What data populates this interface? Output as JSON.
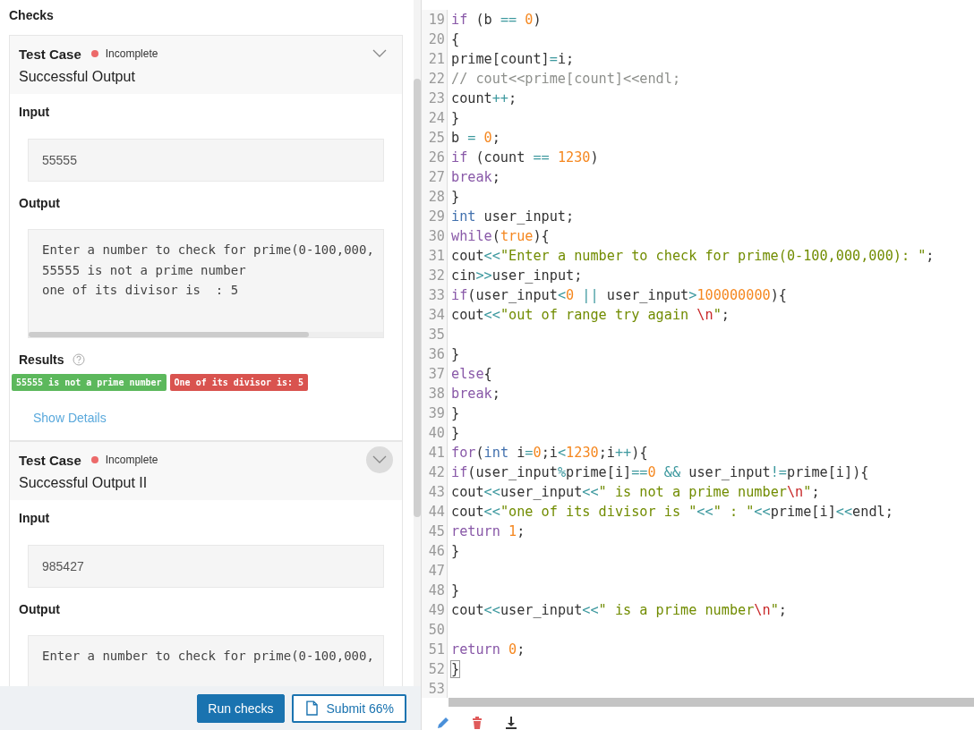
{
  "checks_panel": {
    "title": "Checks",
    "test_cases": [
      {
        "label": "Test Case",
        "status": "Incomplete",
        "color": "#ec6a6a",
        "title": "Successful Output",
        "toggle_hovered": false,
        "input_label": "Input",
        "input": "55555",
        "output_label": "Output",
        "output_lines": [
          "Enter a number to check for prime(0-100,000,",
          "55555 is not a prime number",
          "one of its divisor is  : 5"
        ],
        "results_label": "Results",
        "results": [
          {
            "text": "55555 is not a prime number",
            "kind": "pass"
          },
          {
            "text": "One of its divisor is: 5",
            "kind": "fail"
          }
        ],
        "details_link": "Show Details"
      },
      {
        "label": "Test Case",
        "status": "Incomplete",
        "color": "#ec6a6a",
        "title": "Successful Output II",
        "toggle_hovered": true,
        "input_label": "Input",
        "input": "985427",
        "output_label": "Output",
        "output_lines": [
          "Enter a number to check for prime(0-100,000,"
        ]
      }
    ],
    "buttons": [
      {
        "label": "Run checks",
        "kind": "primary"
      },
      {
        "label": "Submit 66%",
        "kind": "submit"
      }
    ]
  },
  "editor": {
    "lines": [
      {
        "number": "19",
        "tokens": [
          {
            "kind": "keyword",
            "text": "if"
          },
          {
            "kind": "plain",
            "text": " (b "
          },
          {
            "kind": "operator",
            "text": "=="
          },
          {
            "kind": "number",
            "text": " 0"
          },
          {
            "kind": "plain",
            "text": ")"
          }
        ]
      },
      {
        "number": "20",
        "tokens": [
          {
            "kind": "plain",
            "text": "{"
          }
        ]
      },
      {
        "number": "21",
        "tokens": [
          {
            "kind": "plain",
            "text": "prime[count]"
          },
          {
            "kind": "operator",
            "text": "="
          },
          {
            "kind": "plain",
            "text": "i;"
          }
        ]
      },
      {
        "number": "22",
        "tokens": [
          {
            "kind": "comment",
            "text": "// cout<<prime[count]<<endl;"
          }
        ]
      },
      {
        "number": "23",
        "tokens": [
          {
            "kind": "plain",
            "text": "count"
          },
          {
            "kind": "operator",
            "text": "++"
          },
          {
            "kind": "plain",
            "text": ";"
          }
        ]
      },
      {
        "number": "24",
        "tokens": [
          {
            "kind": "plain",
            "text": "}"
          }
        ]
      },
      {
        "number": "25",
        "tokens": [
          {
            "kind": "plain",
            "text": "b "
          },
          {
            "kind": "operator",
            "text": "="
          },
          {
            "kind": "number",
            "text": " 0"
          },
          {
            "kind": "plain",
            "text": ";"
          }
        ]
      },
      {
        "number": "26",
        "tokens": [
          {
            "kind": "keyword",
            "text": "if"
          },
          {
            "kind": "plain",
            "text": " (count "
          },
          {
            "kind": "operator",
            "text": "=="
          },
          {
            "kind": "number",
            "text": " 1230"
          },
          {
            "kind": "plain",
            "text": ")"
          }
        ]
      },
      {
        "number": "27",
        "tokens": [
          {
            "kind": "keyword",
            "text": "break"
          },
          {
            "kind": "plain",
            "text": ";"
          }
        ]
      },
      {
        "number": "28",
        "tokens": [
          {
            "kind": "plain",
            "text": "}"
          }
        ]
      },
      {
        "number": "29",
        "tokens": [
          {
            "kind": "type",
            "text": "int"
          },
          {
            "kind": "plain",
            "text": " user_input;"
          }
        ]
      },
      {
        "number": "30",
        "tokens": [
          {
            "kind": "keyword",
            "text": "while"
          },
          {
            "kind": "plain",
            "text": "("
          },
          {
            "kind": "number",
            "text": "true"
          },
          {
            "kind": "plain",
            "text": "){"
          }
        ]
      },
      {
        "number": "31",
        "tokens": [
          {
            "kind": "plain",
            "text": "cout"
          },
          {
            "kind": "operator",
            "text": "<<"
          },
          {
            "kind": "string",
            "text": "\"Enter a number to check for prime(0-100,000,000): \""
          },
          {
            "kind": "plain",
            "text": ";"
          }
        ]
      },
      {
        "number": "32",
        "tokens": [
          {
            "kind": "plain",
            "text": "cin"
          },
          {
            "kind": "operator",
            "text": ">>"
          },
          {
            "kind": "plain",
            "text": "user_input;"
          }
        ]
      },
      {
        "number": "33",
        "tokens": [
          {
            "kind": "keyword",
            "text": "if"
          },
          {
            "kind": "plain",
            "text": "(user_input"
          },
          {
            "kind": "operator",
            "text": "<"
          },
          {
            "kind": "number",
            "text": "0"
          },
          {
            "kind": "operator",
            "text": " ||"
          },
          {
            "kind": "plain",
            "text": " user_input"
          },
          {
            "kind": "operator",
            "text": ">"
          },
          {
            "kind": "number",
            "text": "100000000"
          },
          {
            "kind": "plain",
            "text": "){"
          }
        ]
      },
      {
        "number": "34",
        "tokens": [
          {
            "kind": "plain",
            "text": "cout"
          },
          {
            "kind": "operator",
            "text": "<<"
          },
          {
            "kind": "string",
            "text": "\"out of range try again "
          },
          {
            "kind": "escape",
            "text": "\\n"
          },
          {
            "kind": "string",
            "text": "\""
          },
          {
            "kind": "plain",
            "text": ";"
          }
        ]
      },
      {
        "number": "35"
      },
      {
        "number": "36",
        "tokens": [
          {
            "kind": "plain",
            "text": "}"
          }
        ]
      },
      {
        "number": "37",
        "tokens": [
          {
            "kind": "keyword",
            "text": "else"
          },
          {
            "kind": "plain",
            "text": "{"
          }
        ]
      },
      {
        "number": "38",
        "tokens": [
          {
            "kind": "keyword",
            "text": "break"
          },
          {
            "kind": "plain",
            "text": ";"
          }
        ]
      },
      {
        "number": "39",
        "tokens": [
          {
            "kind": "plain",
            "text": "}"
          }
        ]
      },
      {
        "number": "40",
        "tokens": [
          {
            "kind": "plain",
            "text": "}"
          }
        ]
      },
      {
        "number": "41",
        "tokens": [
          {
            "kind": "keyword",
            "text": "for"
          },
          {
            "kind": "plain",
            "text": "("
          },
          {
            "kind": "type",
            "text": "int"
          },
          {
            "kind": "plain",
            "text": " i"
          },
          {
            "kind": "operator",
            "text": "="
          },
          {
            "kind": "number",
            "text": "0"
          },
          {
            "kind": "plain",
            "text": ";i"
          },
          {
            "kind": "operator",
            "text": "<"
          },
          {
            "kind": "number",
            "text": "1230"
          },
          {
            "kind": "plain",
            "text": ";i"
          },
          {
            "kind": "operator",
            "text": "++"
          },
          {
            "kind": "plain",
            "text": "){"
          }
        ]
      },
      {
        "number": "42",
        "tokens": [
          {
            "kind": "keyword",
            "text": "if"
          },
          {
            "kind": "plain",
            "text": "(user_input"
          },
          {
            "kind": "operator",
            "text": "%"
          },
          {
            "kind": "plain",
            "text": "prime[i]"
          },
          {
            "kind": "operator",
            "text": "=="
          },
          {
            "kind": "number",
            "text": "0"
          },
          {
            "kind": "operator",
            "text": " &&"
          },
          {
            "kind": "plain",
            "text": " user_input"
          },
          {
            "kind": "operator",
            "text": "!="
          },
          {
            "kind": "plain",
            "text": "prime[i]){"
          }
        ]
      },
      {
        "number": "43",
        "tokens": [
          {
            "kind": "plain",
            "text": "cout"
          },
          {
            "kind": "operator",
            "text": "<<"
          },
          {
            "kind": "plain",
            "text": "user_input"
          },
          {
            "kind": "operator",
            "text": "<<"
          },
          {
            "kind": "string",
            "text": "\" is not a prime number"
          },
          {
            "kind": "escape",
            "text": "\\n"
          },
          {
            "kind": "string",
            "text": "\""
          },
          {
            "kind": "plain",
            "text": ";"
          }
        ]
      },
      {
        "number": "44",
        "tokens": [
          {
            "kind": "plain",
            "text": "cout"
          },
          {
            "kind": "operator",
            "text": "<<"
          },
          {
            "kind": "string",
            "text": "\"one of its divisor is \""
          },
          {
            "kind": "operator",
            "text": "<<"
          },
          {
            "kind": "string",
            "text": "\" : \""
          },
          {
            "kind": "operator",
            "text": "<<"
          },
          {
            "kind": "plain",
            "text": "prime[i]"
          },
          {
            "kind": "operator",
            "text": "<<"
          },
          {
            "kind": "plain",
            "text": "endl;"
          }
        ]
      },
      {
        "number": "45",
        "tokens": [
          {
            "kind": "keyword",
            "text": "return"
          },
          {
            "kind": "number",
            "text": " 1"
          },
          {
            "kind": "plain",
            "text": ";"
          }
        ]
      },
      {
        "number": "46",
        "tokens": [
          {
            "kind": "plain",
            "text": "}"
          }
        ]
      },
      {
        "number": "47"
      },
      {
        "number": "48",
        "tokens": [
          {
            "kind": "plain",
            "text": "}"
          }
        ]
      },
      {
        "number": "49",
        "tokens": [
          {
            "kind": "plain",
            "text": "cout"
          },
          {
            "kind": "operator",
            "text": "<<"
          },
          {
            "kind": "plain",
            "text": "user_input"
          },
          {
            "kind": "operator",
            "text": "<<"
          },
          {
            "kind": "string",
            "text": "\" is a prime number"
          },
          {
            "kind": "escape",
            "text": "\\n"
          },
          {
            "kind": "string",
            "text": "\""
          },
          {
            "kind": "plain",
            "text": ";"
          }
        ]
      },
      {
        "number": "50"
      },
      {
        "number": "51",
        "tokens": [
          {
            "kind": "keyword",
            "text": "return"
          },
          {
            "kind": "number",
            "text": " 0"
          },
          {
            "kind": "plain",
            "text": ";"
          }
        ]
      },
      {
        "number": "52",
        "tokens": [
          {
            "kind": "bracket_match",
            "text": "}"
          }
        ]
      },
      {
        "number": "53"
      }
    ]
  }
}
